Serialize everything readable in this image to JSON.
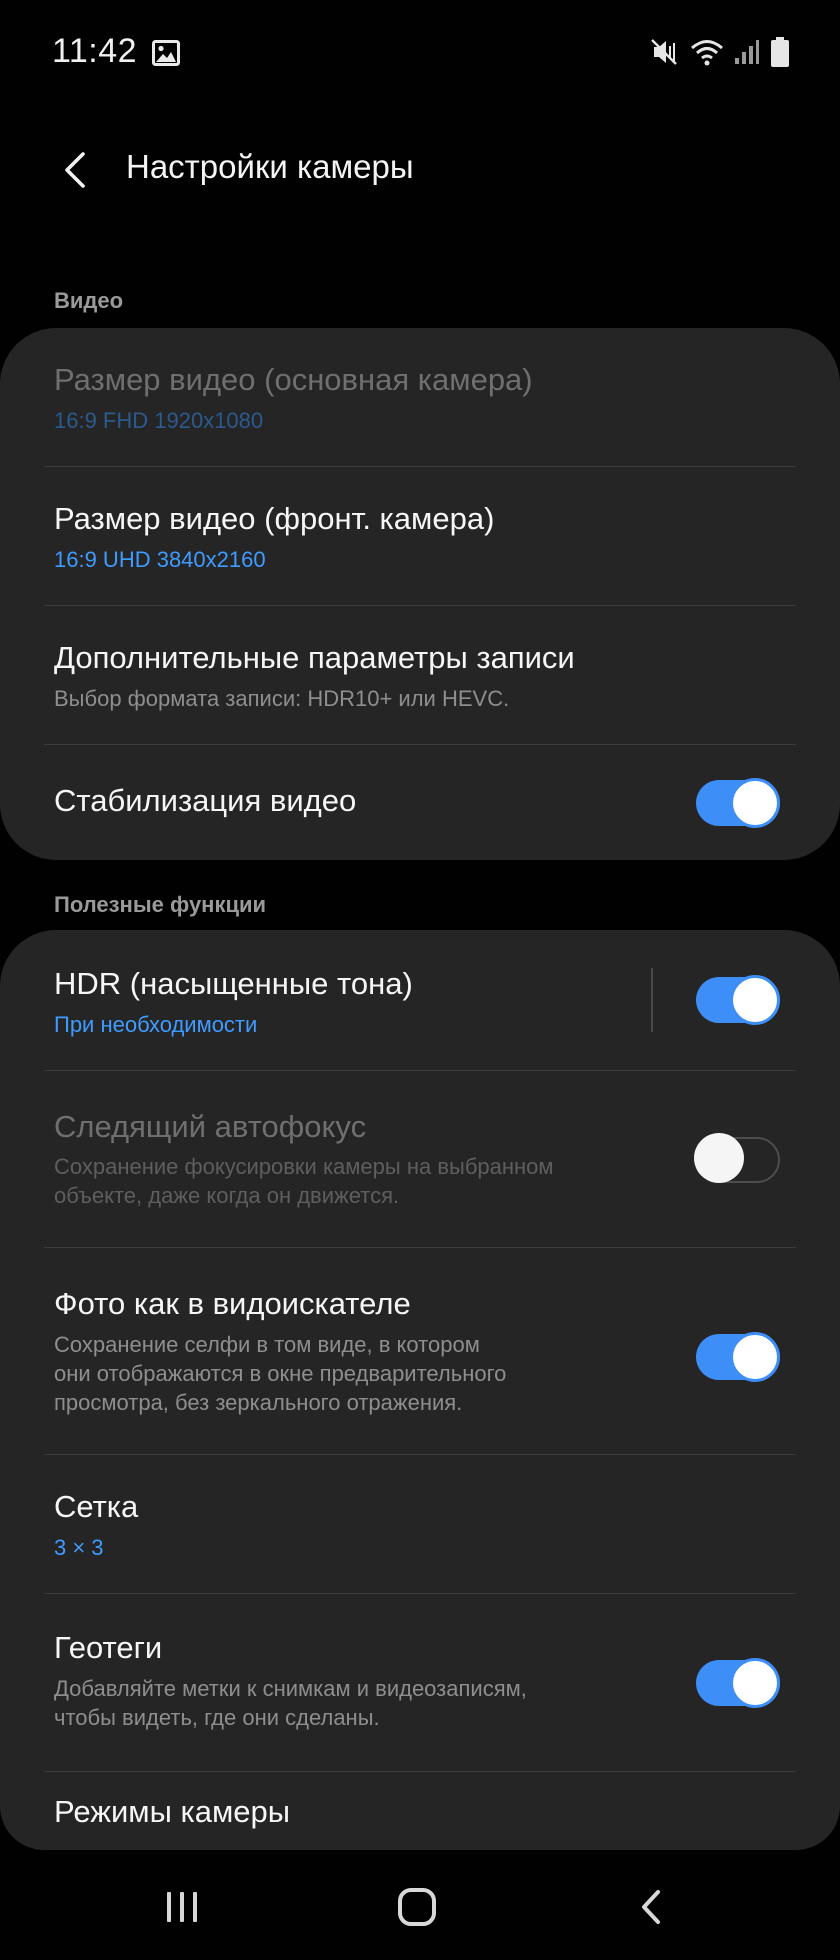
{
  "status_bar": {
    "time": "11:42",
    "icons": [
      "gallery-icon",
      "mute-vibrate-icon",
      "wifi-icon",
      "cellular-signal-icon",
      "battery-icon"
    ]
  },
  "header": {
    "title": "Настройки камеры",
    "back_icon": "back-arrow-icon"
  },
  "sections": {
    "video": {
      "label": "Видео",
      "items": [
        {
          "title": "Размер видео (основная камера)",
          "subtitle": "16:9 FHD 1920x1080",
          "enabled": false
        },
        {
          "title": "Размер видео (фронт. камера)",
          "subtitle": "16:9 UHD 3840x2160"
        },
        {
          "title": "Дополнительные параметры записи",
          "subtitle": "Выбор формата записи: HDR10+ или HEVC."
        },
        {
          "title": "Стабилизация видео",
          "toggle": true
        }
      ]
    },
    "useful": {
      "label": "Полезные функции",
      "items": [
        {
          "title": "HDR (насыщенные тона)",
          "subtitle": "При необходимости",
          "toggle": true
        },
        {
          "title": "Следящий автофокус",
          "subtitle_lines": [
            "Сохранение фокусировки камеры на выбранном",
            "объекте, даже когда он движется."
          ],
          "toggle": false,
          "enabled": false
        },
        {
          "title": "Фото как в видоискателе",
          "subtitle_lines": [
            "Сохранение селфи в том виде, в котором",
            "они отображаются в окне предварительного",
            "просмотра, без зеркального отражения."
          ],
          "toggle": true
        },
        {
          "title": "Сетка",
          "subtitle": "3 × 3"
        },
        {
          "title": "Геотеги",
          "subtitle_lines": [
            "Добавляйте метки к снимкам и видеозаписям,",
            "чтобы видеть, где они сделаны."
          ],
          "toggle": true
        },
        {
          "title": "Режимы камеры"
        }
      ]
    }
  },
  "nav_bar": {
    "icons": [
      "recent-apps-icon",
      "home-icon",
      "nav-back-icon"
    ]
  },
  "colors": {
    "background": "#010101",
    "card": "#252525",
    "accent": "#3e8ef7",
    "link_blue": "#3e9bff"
  }
}
